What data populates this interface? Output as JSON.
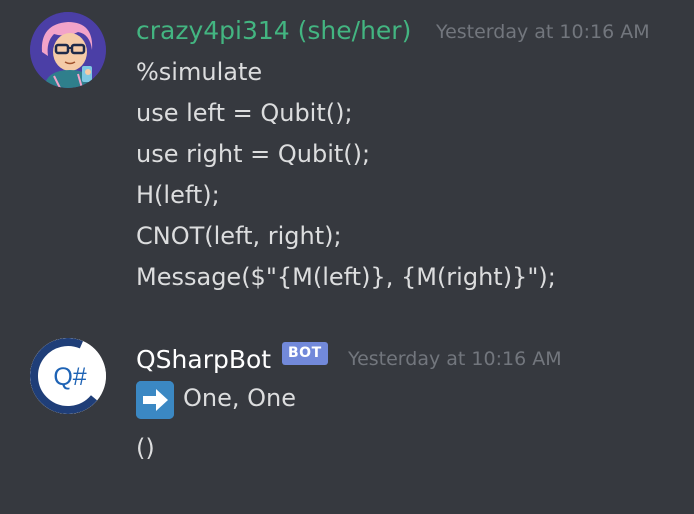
{
  "messages": [
    {
      "author": "crazy4pi314 (she/her)",
      "author_color": "#43b581",
      "timestamp": "Yesterday at 10:16 AM",
      "avatar_icon": "user-avatar-icon",
      "lines": [
        "%simulate",
        "use left = Qubit();",
        "use right = Qubit();",
        "H(left);",
        "CNOT(left, right);",
        "Message($\"{M(left)}, {M(right)}\");"
      ]
    },
    {
      "author": "QSharpBot",
      "author_color": "#ffffff",
      "badge": "BOT",
      "timestamp": "Yesterday at 10:16 AM",
      "avatar_icon": "qsharp-logo-icon",
      "avatar_text": "Q#",
      "result_icon": "arrow-right-icon",
      "result_text": "One, One",
      "unit_text": "()"
    }
  ],
  "colors": {
    "background": "#36393f",
    "muted": "#72767d",
    "text": "#dcddde",
    "bot_badge": "#7289da",
    "arrow_emoji": "#3b88c3"
  }
}
